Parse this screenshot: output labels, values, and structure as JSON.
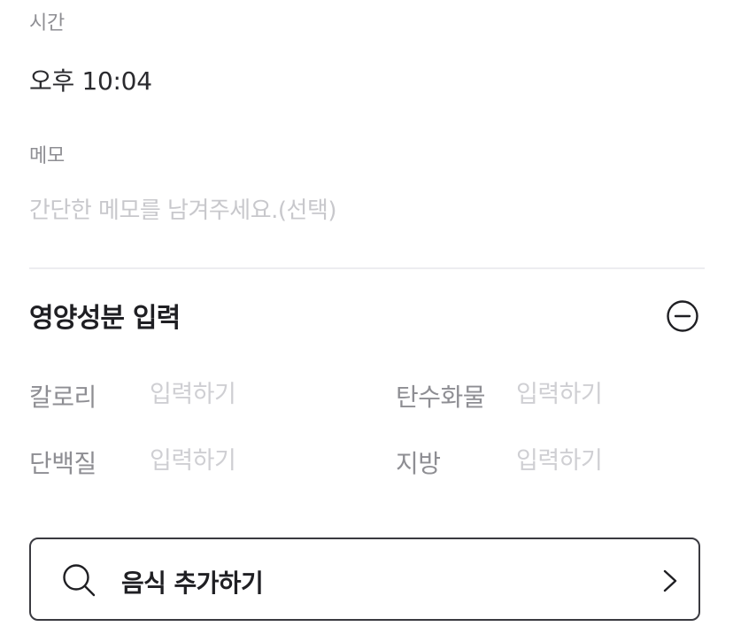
{
  "time": {
    "label": "시간",
    "value": "오후 10:04"
  },
  "memo": {
    "label": "메모",
    "placeholder": "간단한 메모를 남겨주세요.(선택)",
    "value": ""
  },
  "nutrition": {
    "title": "영양성분 입력",
    "collapse_icon": "minus-circle-icon",
    "fields": [
      {
        "label": "칼로리",
        "placeholder": "입력하기"
      },
      {
        "label": "탄수화물",
        "placeholder": "입력하기"
      },
      {
        "label": "단백질",
        "placeholder": "입력하기"
      },
      {
        "label": "지방",
        "placeholder": "입력하기"
      }
    ]
  },
  "add_food": {
    "label": "음식 추가하기",
    "icon": "search-icon",
    "trailing_icon": "chevron-right-icon"
  },
  "colors": {
    "text_primary": "#1f1f23",
    "text_secondary": "#8e8e93",
    "placeholder": "#c8c8cc",
    "divider": "#ededf0",
    "button_border": "#3a3a40"
  }
}
